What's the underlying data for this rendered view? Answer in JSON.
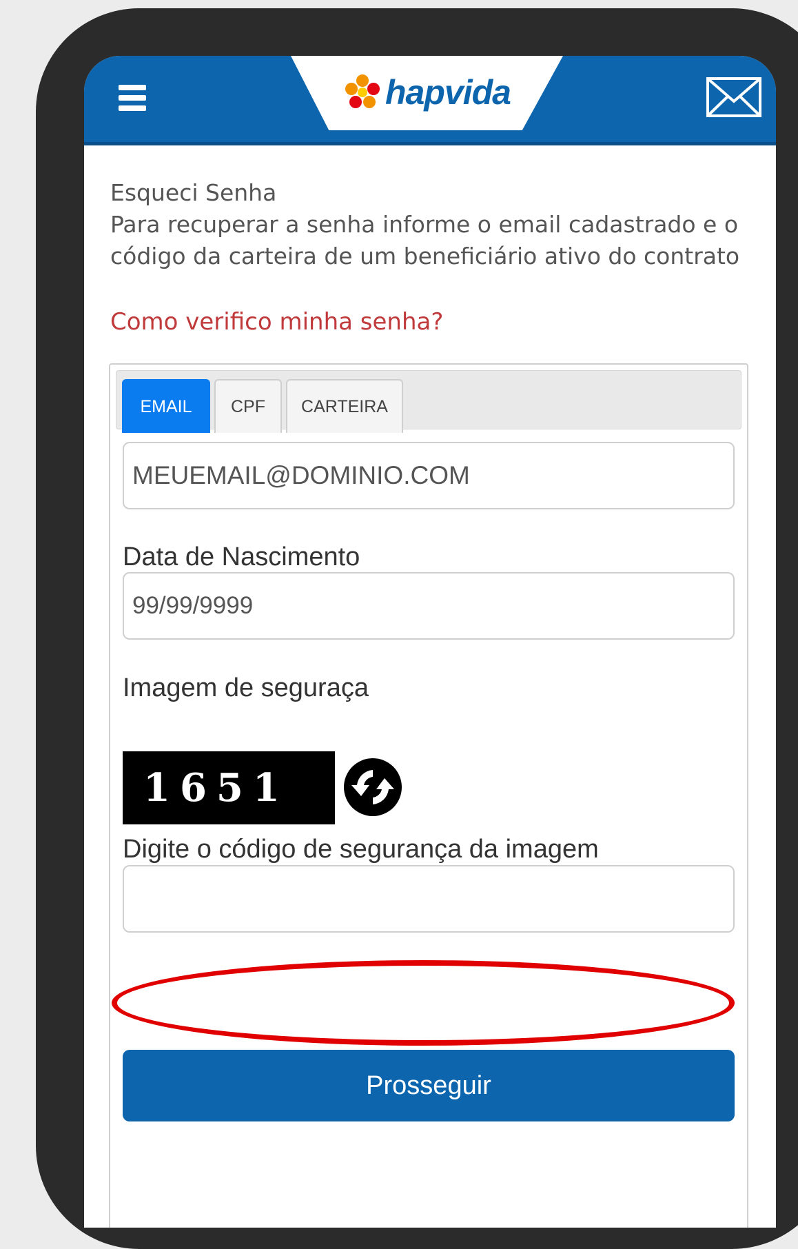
{
  "header": {
    "logo_text": "hapvida",
    "menu_icon": "hamburger-menu-icon",
    "mail_icon": "envelope-icon",
    "bg_color": "#0d65ae"
  },
  "intro": {
    "title": "Esqueci Senha",
    "description": "Para recuperar a senha informe o email cadastrado e o código da carteira de um beneficiário ativo do contrato"
  },
  "help_link": "Como verifico minha senha?",
  "tabs": [
    {
      "label": "EMAIL",
      "active": true
    },
    {
      "label": "CPF",
      "active": false
    },
    {
      "label": "CARTEIRA",
      "active": false
    }
  ],
  "form": {
    "email_placeholder": "MEUEMAIL@DOMINIO.COM",
    "birth_label": "Data de Nascimento",
    "birth_placeholder": "99/99/9999",
    "captcha_label": "Imagem de seguraça",
    "captcha_text": "1651",
    "code_label": "Digite o código de segurança da imagem",
    "code_value": "",
    "submit_label": "Prosseguir"
  },
  "colors": {
    "accent": "#0d65ae",
    "active_tab": "#0a7cf0",
    "link": "#c0393b",
    "highlight": "#e00000"
  }
}
